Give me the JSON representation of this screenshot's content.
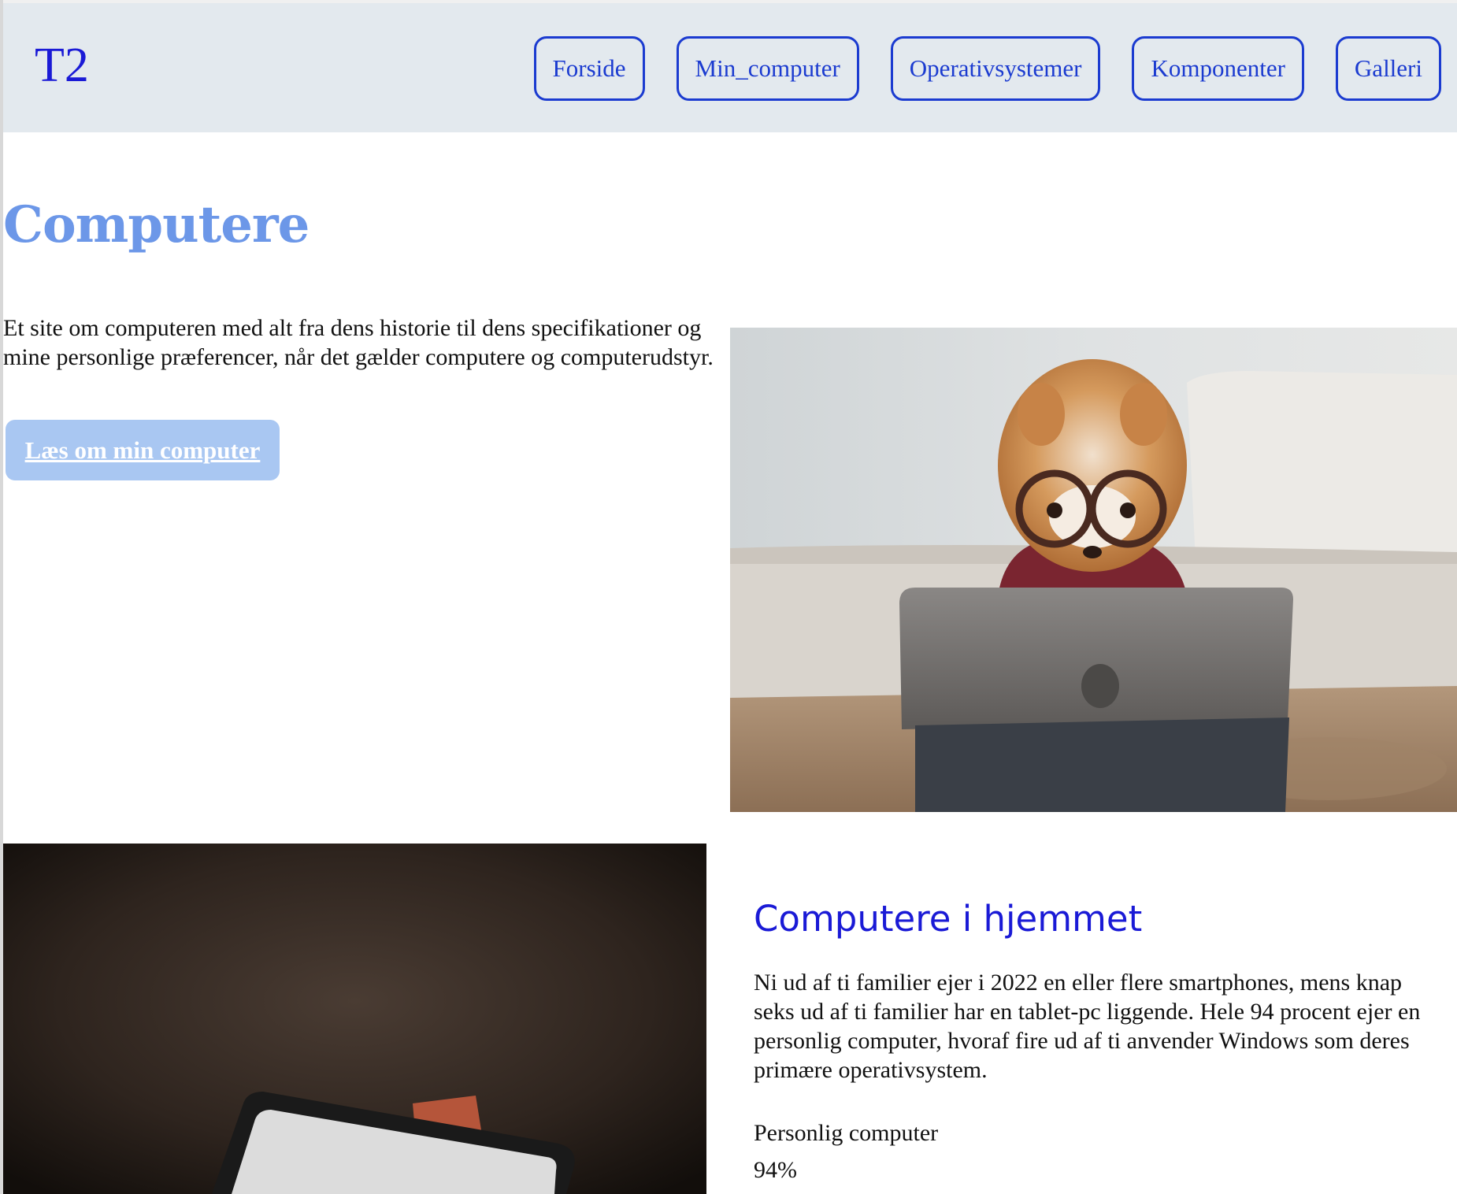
{
  "header": {
    "logo": "T2",
    "nav": [
      {
        "label": "Forside"
      },
      {
        "label": "Min_computer"
      },
      {
        "label": "Operativsystemer"
      },
      {
        "label": "Komponenter"
      },
      {
        "label": "Galleri"
      }
    ]
  },
  "hero": {
    "title": "Computere",
    "intro": "Et site om computeren med alt fra dens historie til dens specifikationer og mine personlige præferencer, når det gælder computere og computerudstyr.",
    "cta_label": "Læs om min computer"
  },
  "section": {
    "title": "Computere i hjemmet",
    "text": "Ni ud af ti familier ejer i 2022 en eller flere smartphones, mens knap seks ud af ti familier har en tablet-pc liggende. Hele 94 procent ejer en personlig computer, hvoraf fire ud af ti anvender Windows som deres primære operativsystem.",
    "stat_label": "Personlig computer",
    "stat_value": "94%"
  },
  "colors": {
    "accent": "#1a1ad6",
    "title": "#6c97e8",
    "cta_bg": "#a9c7f2",
    "header_bg": "#e3e9ee"
  }
}
